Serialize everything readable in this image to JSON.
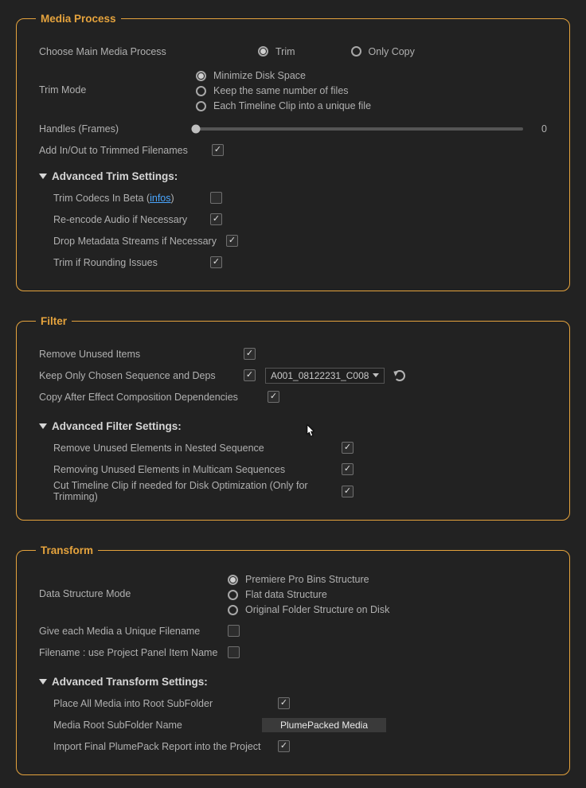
{
  "mediaProcess": {
    "legend": "Media Process",
    "chooseMain": {
      "label": "Choose Main Media Process",
      "options": {
        "trim": "Trim",
        "onlyCopy": "Only Copy"
      }
    },
    "trimMode": {
      "label": "Trim Mode",
      "options": {
        "minDisk": "Minimize Disk Space",
        "keepSame": "Keep the same number of files",
        "eachUnique": "Each Timeline Clip into a unique file"
      }
    },
    "handles": {
      "label": "Handles (Frames)",
      "value": "0"
    },
    "addInOut": {
      "label": "Add In/Out to Trimmed Filenames"
    },
    "advHead": "Advanced Trim Settings:",
    "adv": {
      "beta": {
        "prefix": "Trim Codecs In Beta (",
        "link": "infos",
        "suffix": ")"
      },
      "reencode": "Re-encode Audio if Necessary",
      "dropMeta": "Drop Metadata Streams if Necessary",
      "rounding": "Trim if Rounding Issues"
    }
  },
  "filter": {
    "legend": "Filter",
    "removeUnused": "Remove Unused Items",
    "keepOnly": {
      "label": "Keep Only Chosen Sequence and Deps",
      "value": "A001_08122231_C008"
    },
    "copyAE": "Copy After Effect Composition Dependencies",
    "advHead": "Advanced Filter Settings:",
    "adv": {
      "nested": "Remove Unused Elements in Nested Sequence",
      "multicam": "Removing Unused Elements in Multicam Sequences",
      "cutTimeline": "Cut Timeline Clip if needed for Disk Optimization (Only for Trimming)"
    }
  },
  "transform": {
    "legend": "Transform",
    "dataStructMode": {
      "label": "Data Structure Mode",
      "options": {
        "ppro": "Premiere Pro Bins Structure",
        "flat": "Flat data Structure",
        "orig": "Original Folder Structure on Disk"
      }
    },
    "uniqueFilename": "Give each Media a Unique Filename",
    "projectPanel": "Filename : use Project Panel Item Name",
    "advHead": "Advanced Transform Settings:",
    "adv": {
      "placeRoot": "Place All Media into Root SubFolder",
      "rootName": {
        "label": "Media Root SubFolder Name",
        "value": "PlumePacked Media"
      },
      "importReport": "Import Final PlumePack Report into the Project"
    }
  }
}
